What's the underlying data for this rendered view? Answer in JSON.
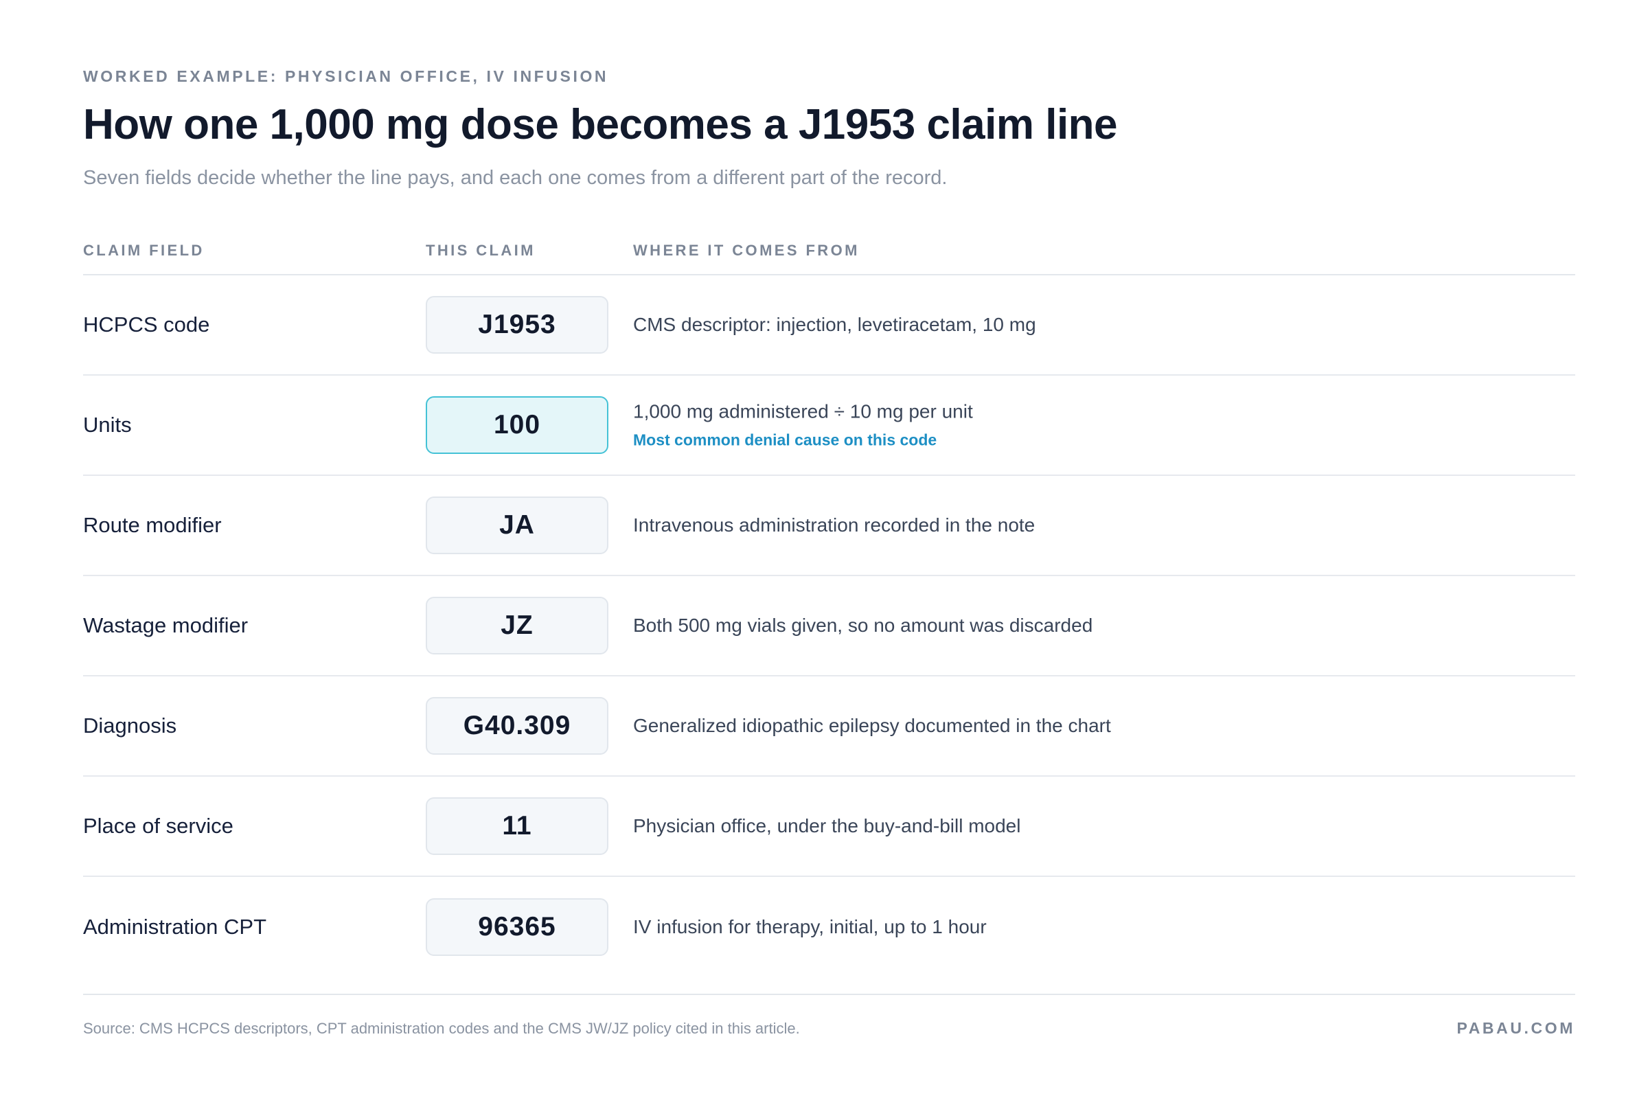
{
  "header": {
    "eyebrow": "WORKED EXAMPLE: PHYSICIAN OFFICE, IV INFUSION",
    "title": "How one 1,000 mg dose becomes a J1953 claim line",
    "subtitle": "Seven fields decide whether the line pays, and each one comes from a different part of the record."
  },
  "table": {
    "columns": [
      "CLAIM FIELD",
      "THIS CLAIM",
      "WHERE IT COMES FROM"
    ],
    "rows": [
      {
        "field": "HCPCS code",
        "value": "J1953",
        "source": "CMS descriptor: injection, levetiracetam, 10 mg",
        "note": "",
        "highlight": false
      },
      {
        "field": "Units",
        "value": "100",
        "source": "1,000 mg administered ÷ 10 mg per unit",
        "note": "Most common denial cause on this code",
        "highlight": true
      },
      {
        "field": "Route modifier",
        "value": "JA",
        "source": "Intravenous administration recorded in the note",
        "note": "",
        "highlight": false
      },
      {
        "field": "Wastage modifier",
        "value": "JZ",
        "source": "Both 500 mg vials given, so no amount was discarded",
        "note": "",
        "highlight": false
      },
      {
        "field": "Diagnosis",
        "value": "G40.309",
        "source": "Generalized idiopathic epilepsy documented in the chart",
        "note": "",
        "highlight": false
      },
      {
        "field": "Place of service",
        "value": "11",
        "source": "Physician office, under the buy-and-bill model",
        "note": "",
        "highlight": false
      },
      {
        "field": "Administration CPT",
        "value": "96365",
        "source": "IV infusion for therapy, initial, up to 1 hour",
        "note": "",
        "highlight": false
      }
    ]
  },
  "footer": {
    "source": "Source: CMS HCPCS descriptors, CPT administration codes and the CMS JW/JZ policy cited in this article.",
    "brand": "PABAU.COM"
  },
  "colors": {
    "accent": "#1d8fc4",
    "highlight_fill": "#e4f6f9",
    "highlight_border": "#44c2d6"
  }
}
